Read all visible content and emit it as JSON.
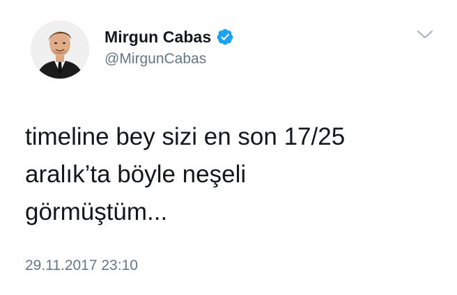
{
  "author": {
    "display_name": "Mirgun Cabas",
    "handle": "@MirgunCabas",
    "verified": true,
    "avatar_icon": "user-avatar"
  },
  "tweet": {
    "lines": [
      "timeline bey sizi en son 17/25",
      "aralık’ta böyle neşeli",
      "görmüştüm..."
    ],
    "timestamp": "29.11.2017 23:10"
  },
  "icons": {
    "verified": "verified-badge-icon",
    "menu": "chevron-down-icon"
  },
  "colors": {
    "text": "#14171a",
    "secondary": "#657786",
    "verified": "#1da1f2",
    "background": "#ffffff"
  }
}
